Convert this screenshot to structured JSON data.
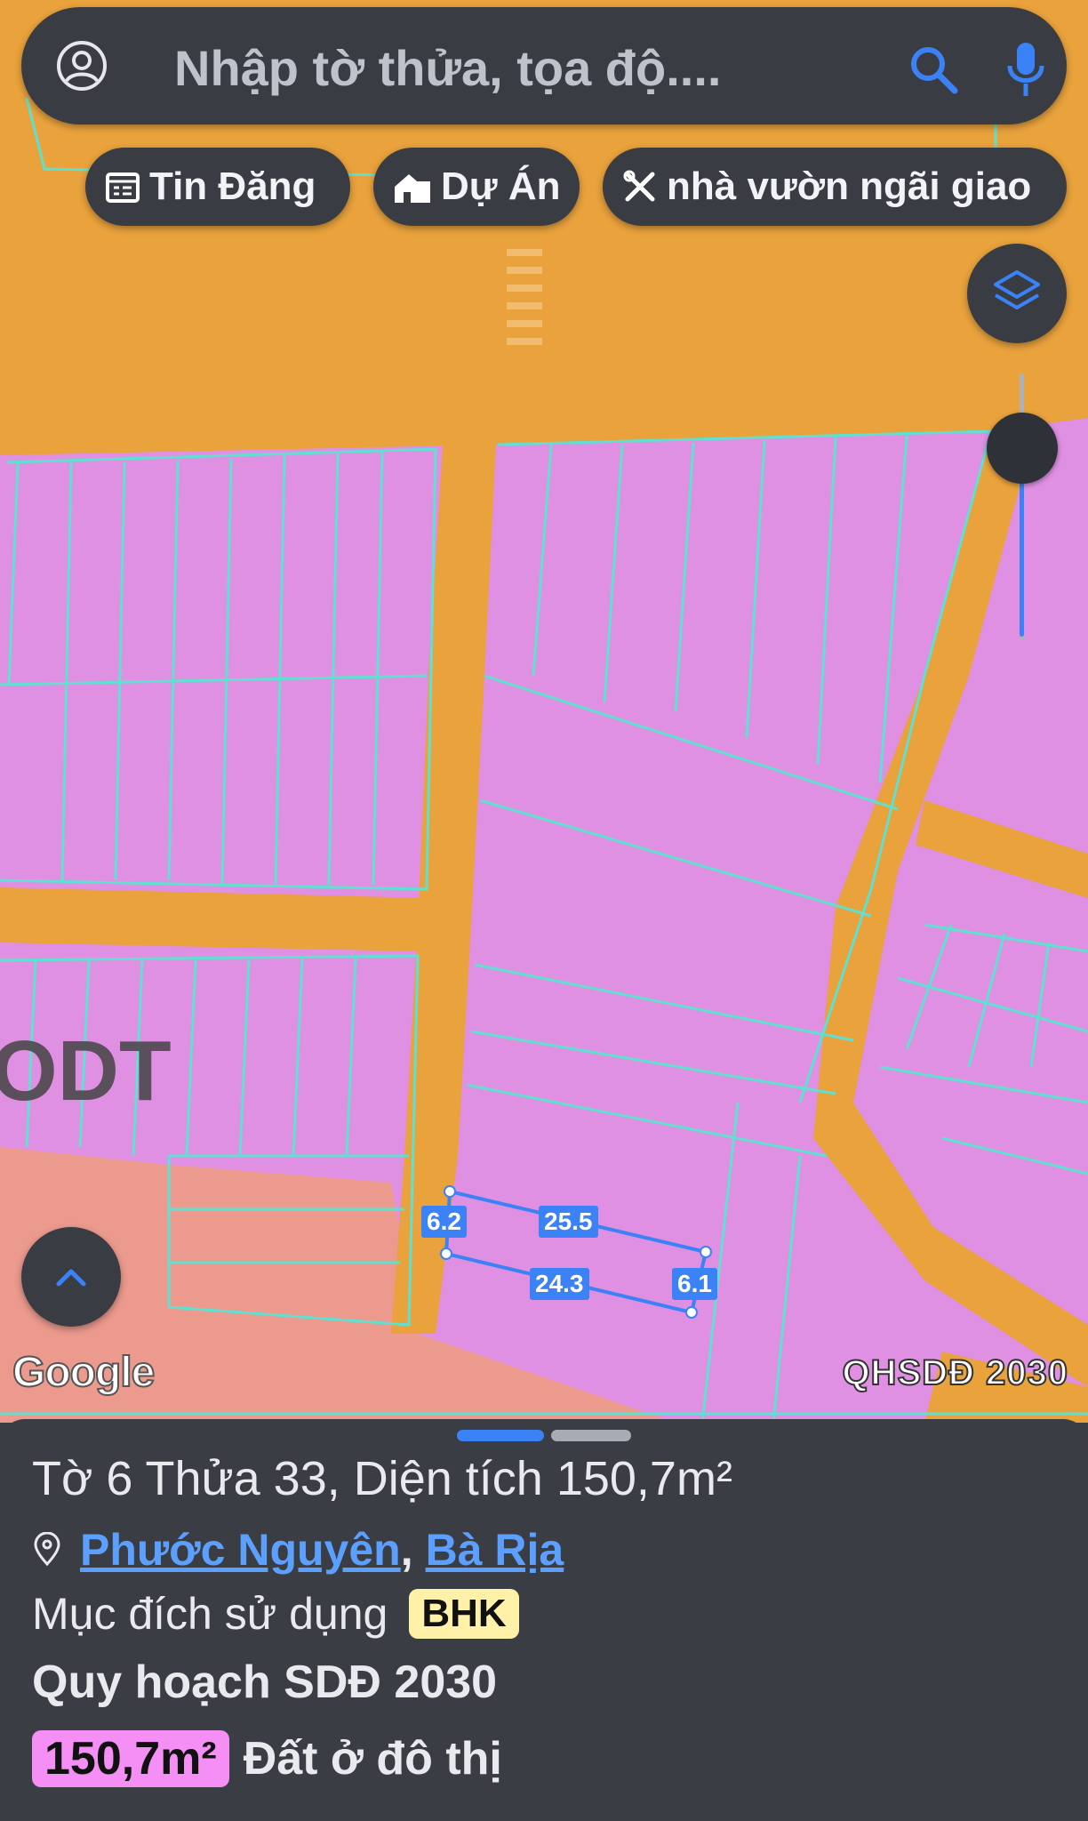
{
  "search": {
    "placeholder": "Nhập tờ thửa, tọa độ...."
  },
  "chips": [
    {
      "label": "Tin Đăng",
      "icon": "calendar-list-icon"
    },
    {
      "label": "Dự Án",
      "icon": "building-icon"
    },
    {
      "label": "nhà vườn ngãi giao",
      "icon": "tools-icon"
    }
  ],
  "map": {
    "zone_label": "ODT",
    "attribution": "Google",
    "layer_name": "QHSDĐ 2030",
    "dimensions": {
      "top": "25.5",
      "bottom": "24.3",
      "left": "6.2",
      "right": "6.1"
    },
    "colors": {
      "road": "#eaa13a",
      "residential": "#e58ee7",
      "parcel_border": "#5fe0d0",
      "selection": "#3b82f6"
    }
  },
  "sheet": {
    "title": "Tờ 6 Thửa 33, Diện tích 150,7m²",
    "ward": "Phước Nguyên",
    "separator": ",",
    "city": "Bà Rịa",
    "purpose_label": "Mục đích sử dụng",
    "purpose_code": "BHK",
    "plan_title": "Quy hoạch SDĐ 2030",
    "plan_area": "150,7m²",
    "plan_type": "Đất ở đô thị"
  }
}
